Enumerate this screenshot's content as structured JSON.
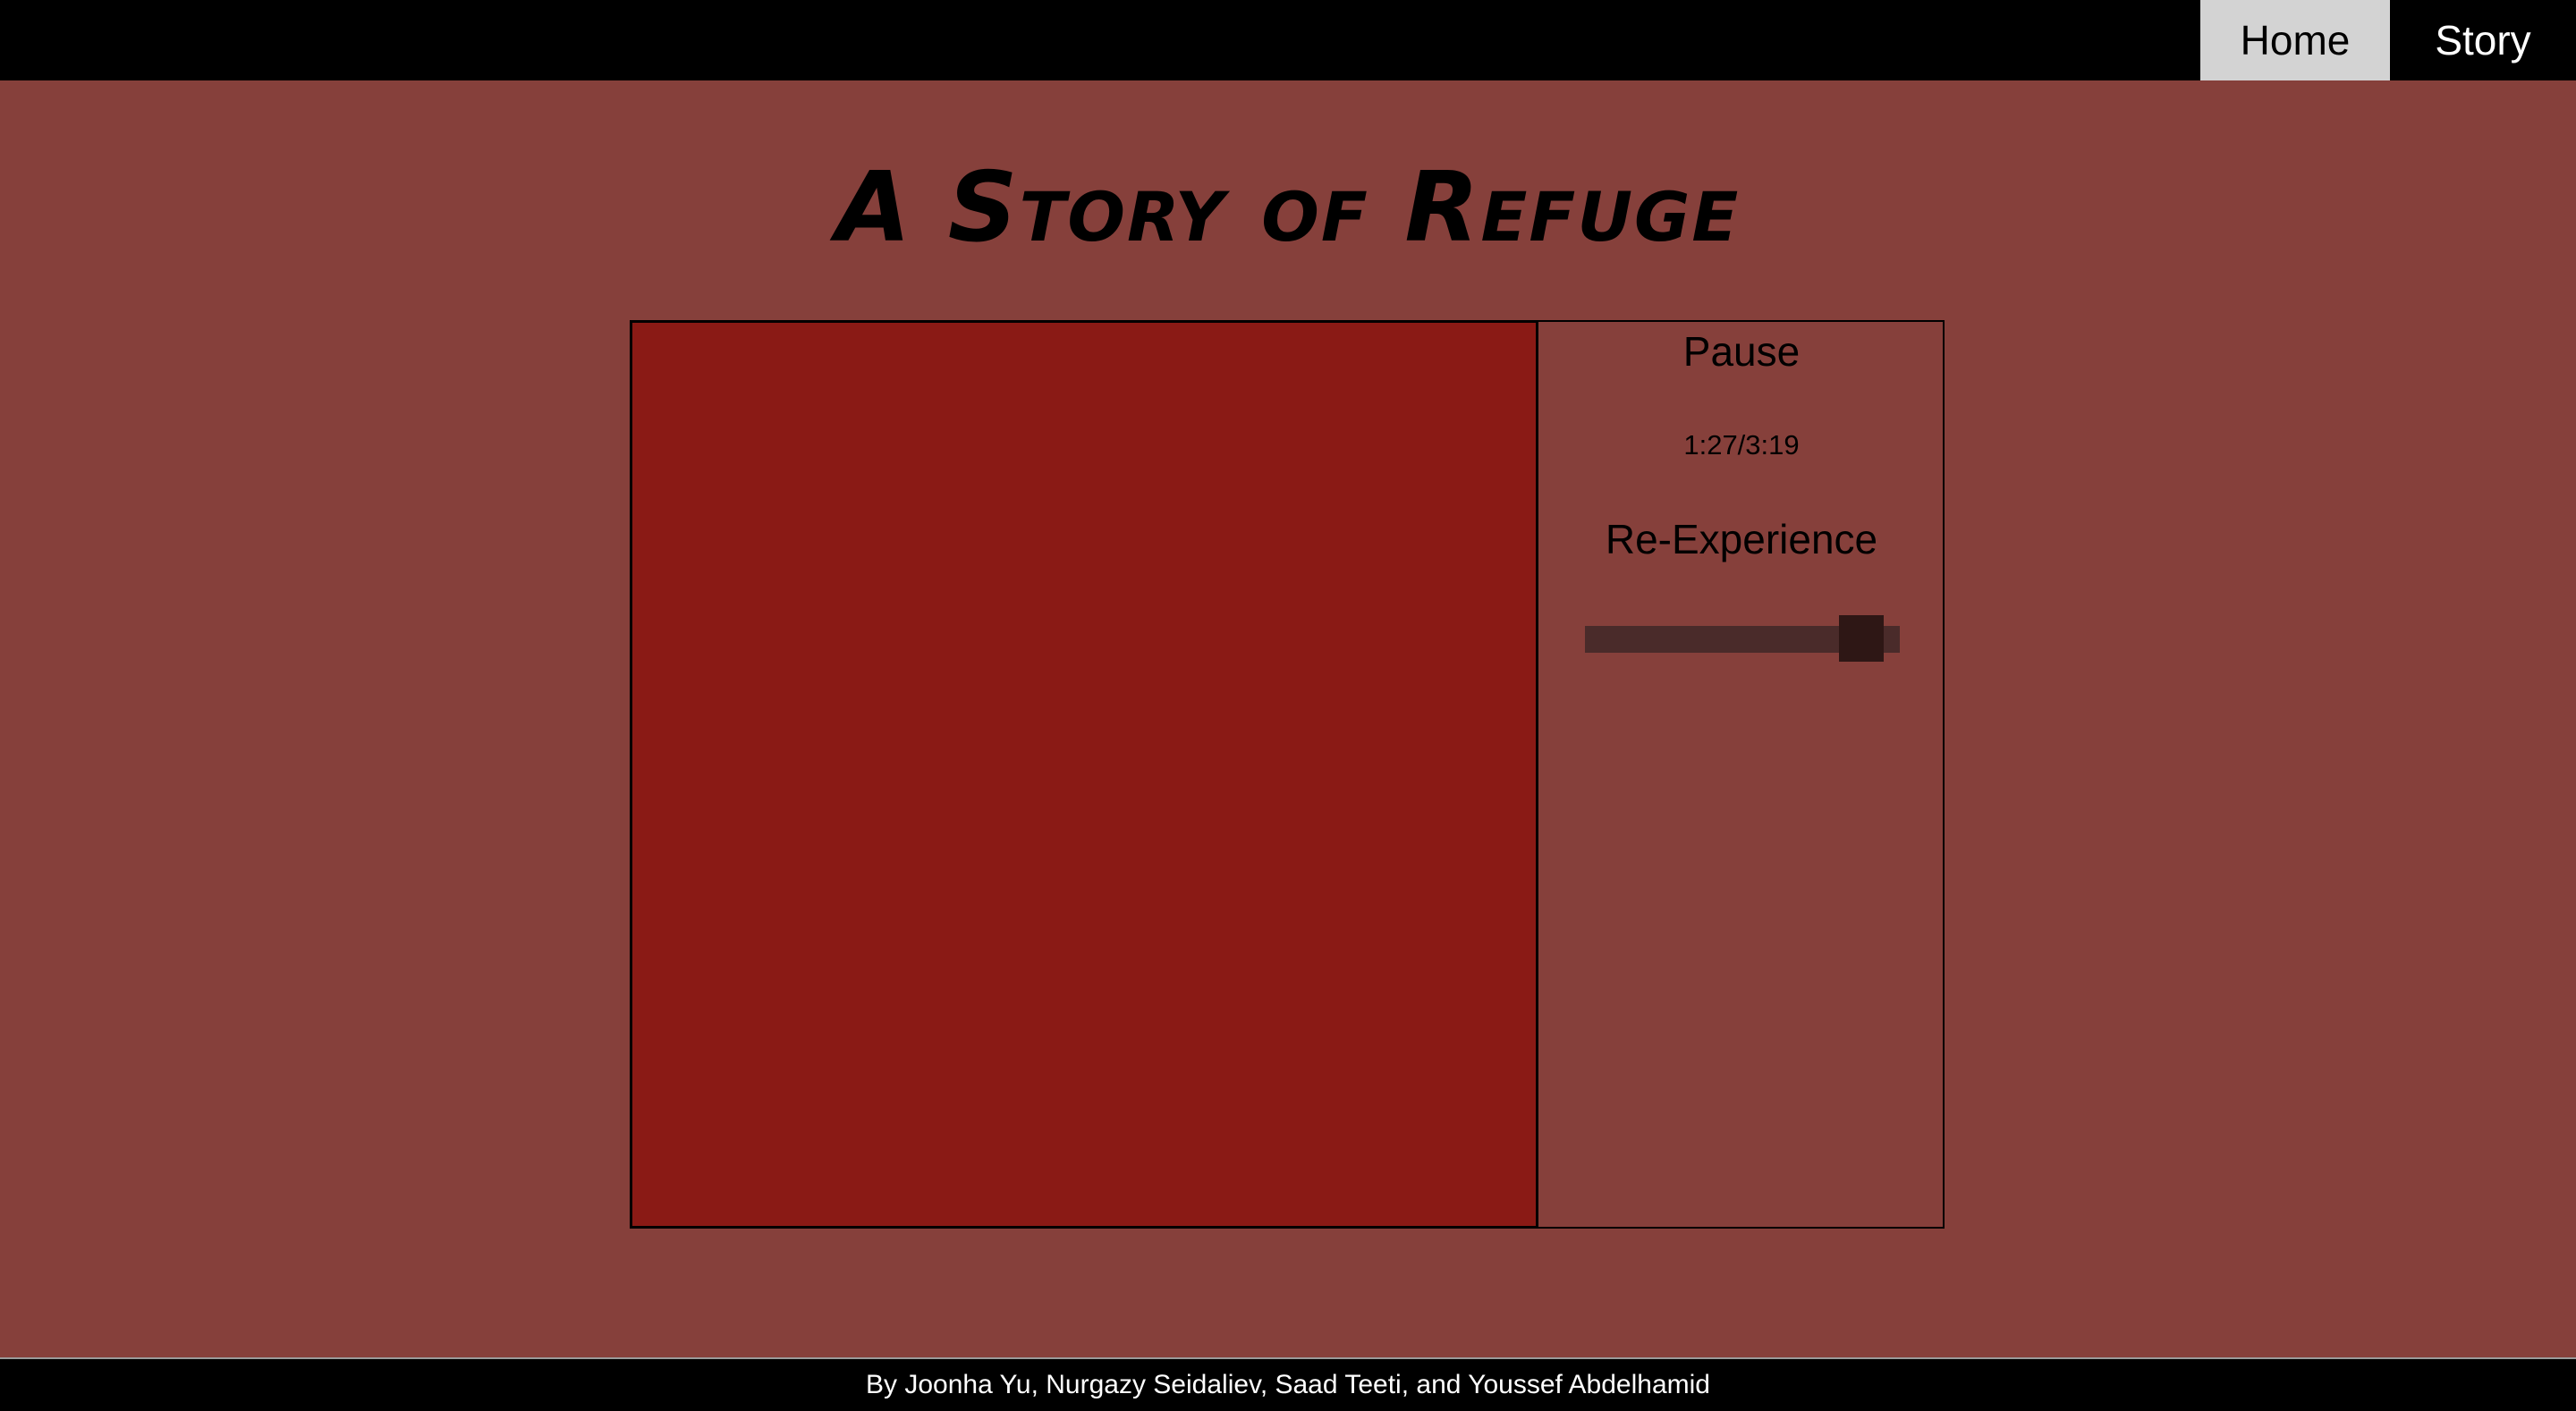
{
  "nav": {
    "home_label": "Home",
    "story_label": "Story"
  },
  "header": {
    "title": "A Story of Refuge"
  },
  "player": {
    "pause_label": "Pause",
    "time": "1:27/3:19",
    "reexperience_label": "Re-Experience",
    "slider_value_fraction": 0.94
  },
  "footer": {
    "credits": "By Joonha Yu, Nurgazy Seidaliev, Saad Teeti, and Youssef Abdelhamid"
  },
  "colors": {
    "background": "#86403b",
    "stage": "#8a1a15",
    "bar": "#000000",
    "active_tab": "#d3d3d3"
  }
}
